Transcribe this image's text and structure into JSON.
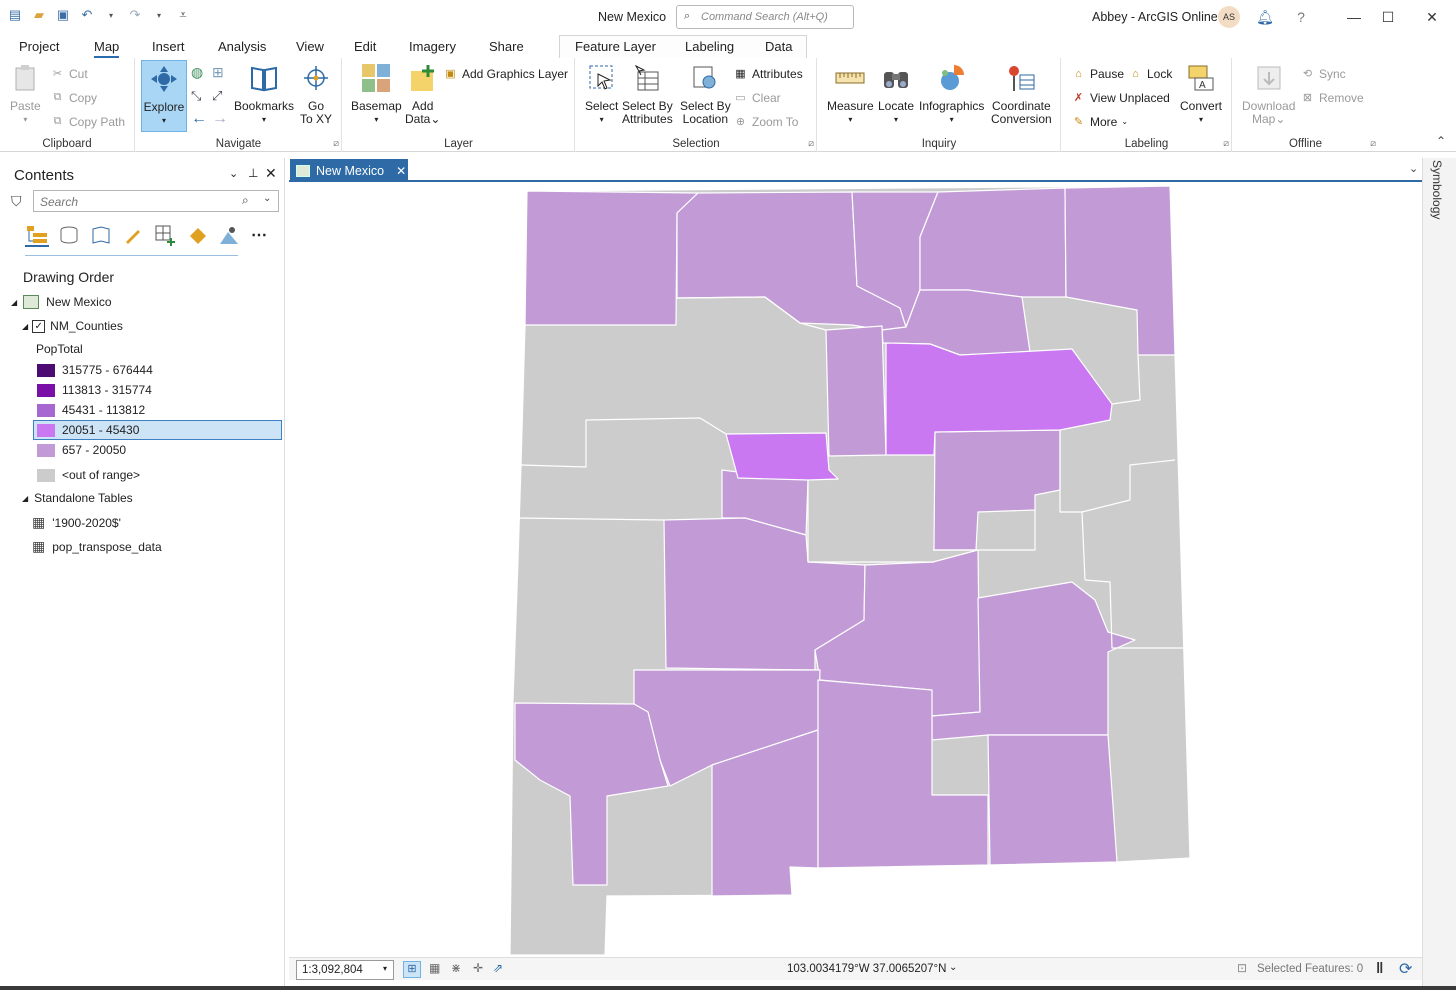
{
  "window": {
    "title": "New Mexico",
    "command_search_placeholder": "Command Search (Alt+Q)",
    "user": "Abbey - ArcGIS Online",
    "avatar_initials": "AS",
    "help": "?"
  },
  "menu_tabs": [
    "Project",
    "Map",
    "Insert",
    "Analysis",
    "View",
    "Edit",
    "Imagery",
    "Share",
    "Feature Layer",
    "Labeling",
    "Data"
  ],
  "ribbon": {
    "clipboard": {
      "label": "Clipboard",
      "paste": "Paste",
      "cut": "Cut",
      "copy": "Copy",
      "copy_path": "Copy Path"
    },
    "navigate": {
      "label": "Navigate",
      "explore": "Explore",
      "bookmarks": "Bookmarks",
      "goto1": "Go",
      "goto2": "To XY"
    },
    "layer": {
      "label": "Layer",
      "basemap": "Basemap",
      "add1": "Add",
      "add2": "Data",
      "add_graphics": "Add Graphics Layer"
    },
    "selection": {
      "label": "Selection",
      "select": "Select",
      "sba1": "Select By",
      "sba2": "Attributes",
      "sbl1": "Select By",
      "sbl2": "Location",
      "attributes": "Attributes",
      "clear": "Clear",
      "zoom_to": "Zoom To"
    },
    "inquiry": {
      "label": "Inquiry",
      "measure": "Measure",
      "locate": "Locate",
      "infographics": "Infographics",
      "coord1": "Coordinate",
      "coord2": "Conversion"
    },
    "labeling": {
      "label": "Labeling",
      "pause": "Pause",
      "lock": "Lock",
      "view_unplaced": "View Unplaced",
      "more": "More",
      "convert": "Convert"
    },
    "offline": {
      "label": "Offline",
      "download1": "Download",
      "download2": "Map",
      "sync": "Sync",
      "remove": "Remove"
    }
  },
  "contents": {
    "title": "Contents",
    "search_placeholder": "Search",
    "drawing_order": "Drawing Order",
    "map_name": "New Mexico",
    "layer_name": "NM_Counties",
    "field": "PopTotal",
    "classes": [
      {
        "label": "315775 - 676444",
        "color": "#4b0b73"
      },
      {
        "label": "113813 - 315774",
        "color": "#7a0fa8"
      },
      {
        "label": "45431 - 113812",
        "color": "#a668d0"
      },
      {
        "label": "20051 - 45430",
        "color": "#c978f2"
      },
      {
        "label": "657 - 20050",
        "color": "#c19ad6"
      },
      {
        "label": "<out of range>",
        "color": "#cccccc"
      }
    ],
    "standalone_tables": "Standalone Tables",
    "tables": [
      "'1900-2020$'",
      "pop_transpose_data"
    ]
  },
  "map_tab": {
    "label": "New Mexico"
  },
  "side_panel": {
    "label": "Symbology"
  },
  "status": {
    "scale": "1:3,092,804",
    "coordinates": "103.0034179°W 37.0065207°N",
    "selected_features": "Selected Features: 0"
  },
  "colors": {
    "accent": "#2d6aa6",
    "low_class": "#c19ad6",
    "mid_class": "#c978f2",
    "gray": "#cccccc"
  }
}
